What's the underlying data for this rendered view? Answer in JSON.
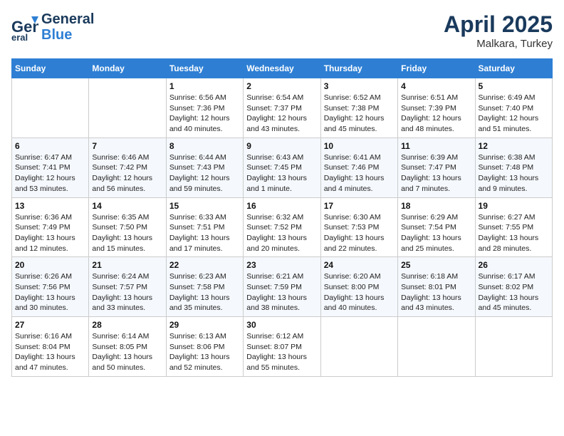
{
  "header": {
    "logo_line1": "General",
    "logo_line2": "Blue",
    "title": "April 2025",
    "location": "Malkara, Turkey"
  },
  "weekdays": [
    "Sunday",
    "Monday",
    "Tuesday",
    "Wednesday",
    "Thursday",
    "Friday",
    "Saturday"
  ],
  "weeks": [
    [
      {
        "day": "",
        "info": ""
      },
      {
        "day": "",
        "info": ""
      },
      {
        "day": "1",
        "info": "Sunrise: 6:56 AM\nSunset: 7:36 PM\nDaylight: 12 hours and 40 minutes."
      },
      {
        "day": "2",
        "info": "Sunrise: 6:54 AM\nSunset: 7:37 PM\nDaylight: 12 hours and 43 minutes."
      },
      {
        "day": "3",
        "info": "Sunrise: 6:52 AM\nSunset: 7:38 PM\nDaylight: 12 hours and 45 minutes."
      },
      {
        "day": "4",
        "info": "Sunrise: 6:51 AM\nSunset: 7:39 PM\nDaylight: 12 hours and 48 minutes."
      },
      {
        "day": "5",
        "info": "Sunrise: 6:49 AM\nSunset: 7:40 PM\nDaylight: 12 hours and 51 minutes."
      }
    ],
    [
      {
        "day": "6",
        "info": "Sunrise: 6:47 AM\nSunset: 7:41 PM\nDaylight: 12 hours and 53 minutes."
      },
      {
        "day": "7",
        "info": "Sunrise: 6:46 AM\nSunset: 7:42 PM\nDaylight: 12 hours and 56 minutes."
      },
      {
        "day": "8",
        "info": "Sunrise: 6:44 AM\nSunset: 7:43 PM\nDaylight: 12 hours and 59 minutes."
      },
      {
        "day": "9",
        "info": "Sunrise: 6:43 AM\nSunset: 7:45 PM\nDaylight: 13 hours and 1 minute."
      },
      {
        "day": "10",
        "info": "Sunrise: 6:41 AM\nSunset: 7:46 PM\nDaylight: 13 hours and 4 minutes."
      },
      {
        "day": "11",
        "info": "Sunrise: 6:39 AM\nSunset: 7:47 PM\nDaylight: 13 hours and 7 minutes."
      },
      {
        "day": "12",
        "info": "Sunrise: 6:38 AM\nSunset: 7:48 PM\nDaylight: 13 hours and 9 minutes."
      }
    ],
    [
      {
        "day": "13",
        "info": "Sunrise: 6:36 AM\nSunset: 7:49 PM\nDaylight: 13 hours and 12 minutes."
      },
      {
        "day": "14",
        "info": "Sunrise: 6:35 AM\nSunset: 7:50 PM\nDaylight: 13 hours and 15 minutes."
      },
      {
        "day": "15",
        "info": "Sunrise: 6:33 AM\nSunset: 7:51 PM\nDaylight: 13 hours and 17 minutes."
      },
      {
        "day": "16",
        "info": "Sunrise: 6:32 AM\nSunset: 7:52 PM\nDaylight: 13 hours and 20 minutes."
      },
      {
        "day": "17",
        "info": "Sunrise: 6:30 AM\nSunset: 7:53 PM\nDaylight: 13 hours and 22 minutes."
      },
      {
        "day": "18",
        "info": "Sunrise: 6:29 AM\nSunset: 7:54 PM\nDaylight: 13 hours and 25 minutes."
      },
      {
        "day": "19",
        "info": "Sunrise: 6:27 AM\nSunset: 7:55 PM\nDaylight: 13 hours and 28 minutes."
      }
    ],
    [
      {
        "day": "20",
        "info": "Sunrise: 6:26 AM\nSunset: 7:56 PM\nDaylight: 13 hours and 30 minutes."
      },
      {
        "day": "21",
        "info": "Sunrise: 6:24 AM\nSunset: 7:57 PM\nDaylight: 13 hours and 33 minutes."
      },
      {
        "day": "22",
        "info": "Sunrise: 6:23 AM\nSunset: 7:58 PM\nDaylight: 13 hours and 35 minutes."
      },
      {
        "day": "23",
        "info": "Sunrise: 6:21 AM\nSunset: 7:59 PM\nDaylight: 13 hours and 38 minutes."
      },
      {
        "day": "24",
        "info": "Sunrise: 6:20 AM\nSunset: 8:00 PM\nDaylight: 13 hours and 40 minutes."
      },
      {
        "day": "25",
        "info": "Sunrise: 6:18 AM\nSunset: 8:01 PM\nDaylight: 13 hours and 43 minutes."
      },
      {
        "day": "26",
        "info": "Sunrise: 6:17 AM\nSunset: 8:02 PM\nDaylight: 13 hours and 45 minutes."
      }
    ],
    [
      {
        "day": "27",
        "info": "Sunrise: 6:16 AM\nSunset: 8:04 PM\nDaylight: 13 hours and 47 minutes."
      },
      {
        "day": "28",
        "info": "Sunrise: 6:14 AM\nSunset: 8:05 PM\nDaylight: 13 hours and 50 minutes."
      },
      {
        "day": "29",
        "info": "Sunrise: 6:13 AM\nSunset: 8:06 PM\nDaylight: 13 hours and 52 minutes."
      },
      {
        "day": "30",
        "info": "Sunrise: 6:12 AM\nSunset: 8:07 PM\nDaylight: 13 hours and 55 minutes."
      },
      {
        "day": "",
        "info": ""
      },
      {
        "day": "",
        "info": ""
      },
      {
        "day": "",
        "info": ""
      }
    ]
  ]
}
